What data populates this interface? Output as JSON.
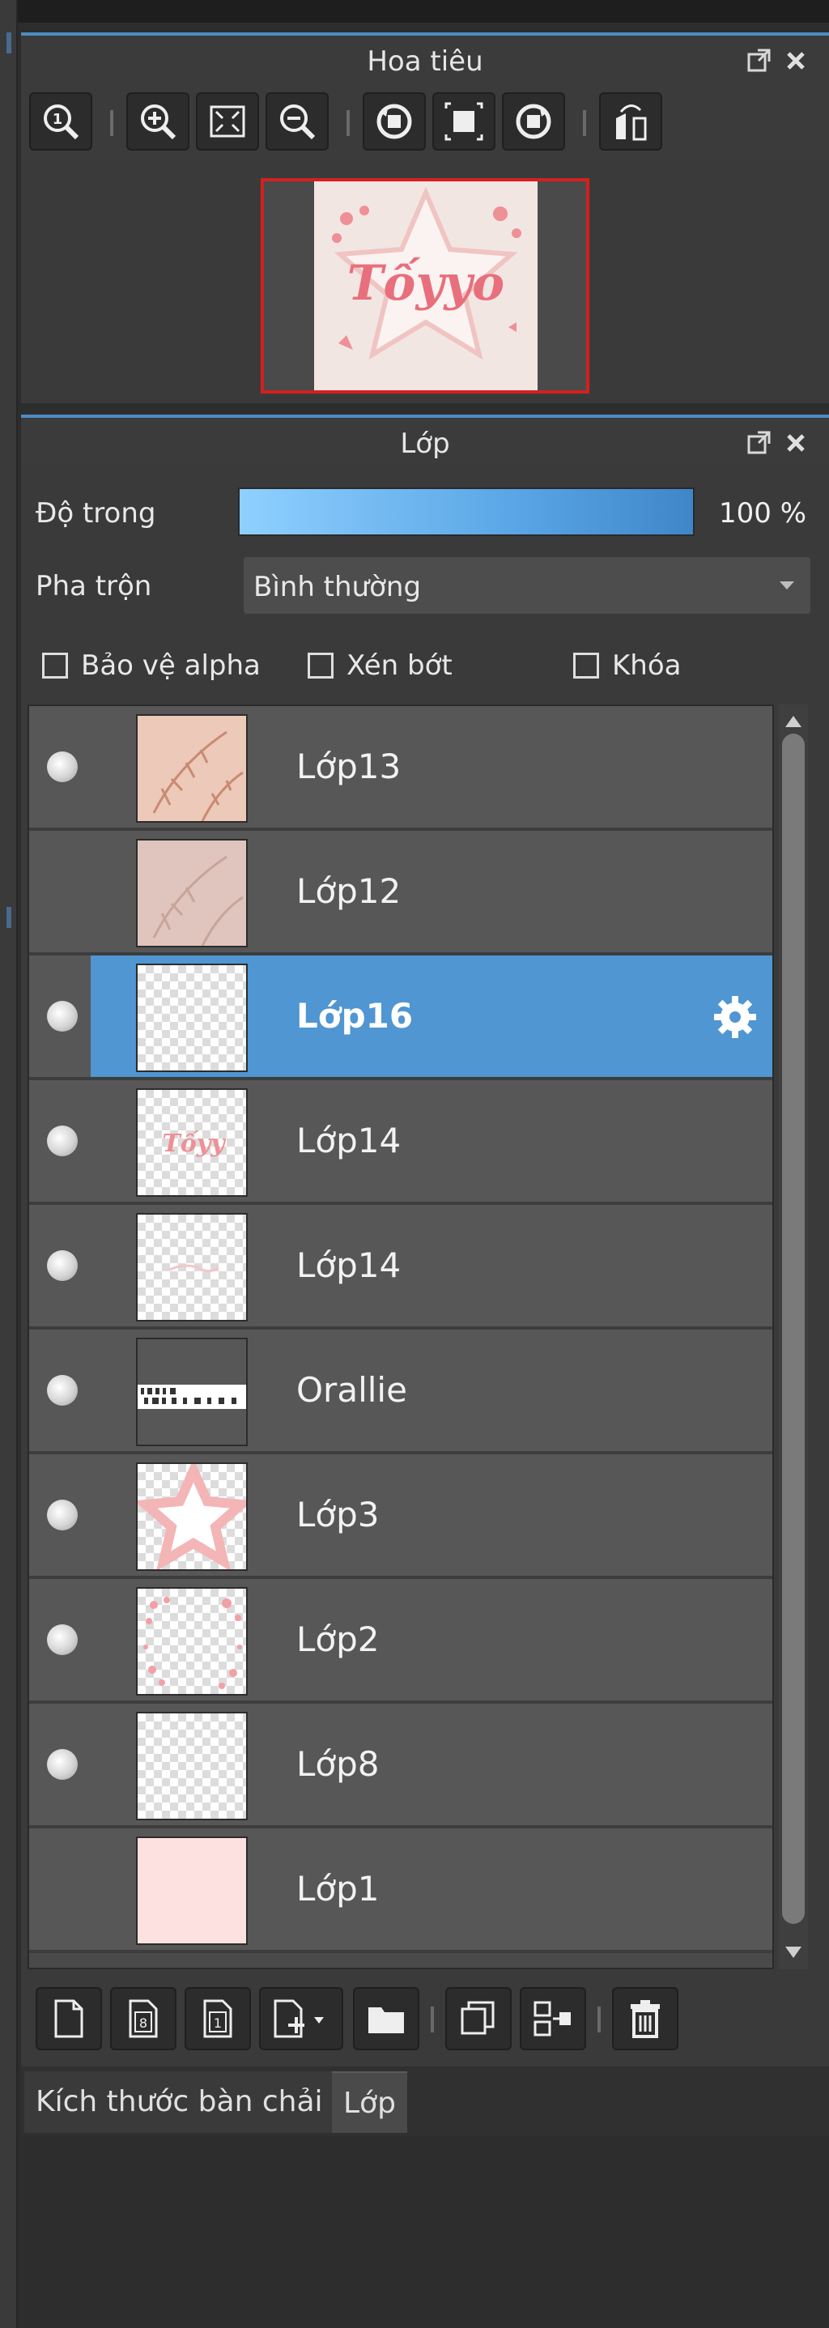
{
  "colors": {
    "accent": "#4f96d2",
    "selection_frame": "#d42020",
    "panel_bg": "#3a3a3a",
    "row_bg": "#575757"
  },
  "navigator": {
    "title": "Hoa tiêu",
    "popout_icon": "popout-icon",
    "close_icon": "close-icon",
    "tools": [
      {
        "name": "zoom-actual-icon"
      },
      {
        "name": "zoom-in-icon"
      },
      {
        "name": "fit-screen-icon"
      },
      {
        "name": "zoom-out-icon"
      },
      {
        "name": "rotate-left-icon"
      },
      {
        "name": "fit-canvas-icon"
      },
      {
        "name": "rotate-right-icon"
      },
      {
        "name": "flip-horizontal-icon"
      }
    ],
    "preview_text": "Tốyyo"
  },
  "layers": {
    "title": "Lớp",
    "opacity_label": "Độ trong",
    "opacity_value": "100 %",
    "opacity_fraction": 1.0,
    "blend_label": "Pha trộn",
    "blend_value": "Bình thường",
    "protect_alpha": "Bảo vệ alpha",
    "clipping": "Xén bớt",
    "lock": "Khóa",
    "items": [
      {
        "name": "Lớp13",
        "visible": true,
        "thumb": "peach-leaves"
      },
      {
        "name": "Lớp12",
        "visible": false,
        "thumb": "peach-leaves-faded"
      },
      {
        "name": "Lớp16",
        "visible": true,
        "thumb": "transparent",
        "selected": true
      },
      {
        "name": "Lớp14",
        "visible": true,
        "thumb": "pink-text"
      },
      {
        "name": "Lớp14",
        "visible": true,
        "thumb": "transparent-faint"
      },
      {
        "name": "Orallie",
        "visible": true,
        "thumb": "text-strip"
      },
      {
        "name": "Lớp3",
        "visible": true,
        "thumb": "pink-star"
      },
      {
        "name": "Lớp2",
        "visible": true,
        "thumb": "pink-dots"
      },
      {
        "name": "Lớp8",
        "visible": true,
        "thumb": "transparent"
      },
      {
        "name": "Lớp1",
        "visible": false,
        "thumb": "pink-fill"
      }
    ],
    "bottom_tools": [
      {
        "name": "new-layer-icon"
      },
      {
        "name": "new-8bit-layer-icon"
      },
      {
        "name": "new-1bit-layer-icon"
      },
      {
        "name": "add-special-layer-icon"
      },
      {
        "name": "new-folder-icon"
      },
      {
        "name": "duplicate-layer-icon"
      },
      {
        "name": "merge-down-icon"
      },
      {
        "name": "delete-layer-icon"
      }
    ]
  },
  "bottom_tabs": {
    "brush_size": "Kích thước bàn chải",
    "layers": "Lớp"
  }
}
